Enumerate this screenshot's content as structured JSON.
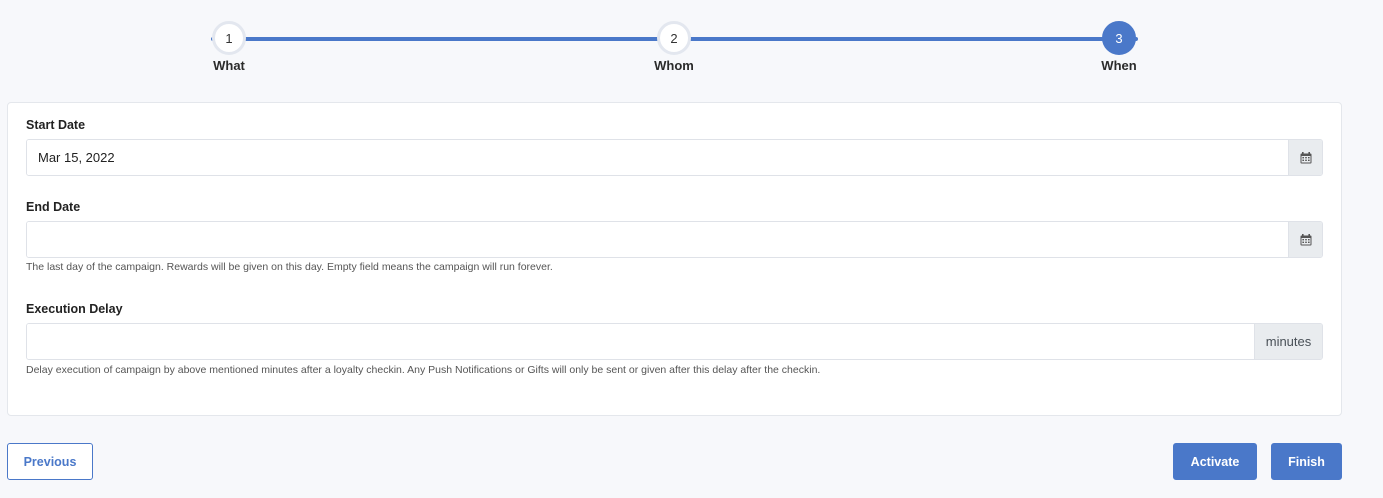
{
  "stepper": {
    "steps": [
      {
        "number": "1",
        "label": "What",
        "active": false
      },
      {
        "number": "2",
        "label": "Whom",
        "active": false
      },
      {
        "number": "3",
        "label": "When",
        "active": true
      }
    ],
    "accent_color": "#4a78c9"
  },
  "form": {
    "start_date": {
      "label": "Start Date",
      "value": "Mar 15, 2022",
      "addon_icon": "calendar-icon"
    },
    "end_date": {
      "label": "End Date",
      "value": "",
      "addon_icon": "calendar-icon",
      "help": "The last day of the campaign. Rewards will be given on this day. Empty field means the campaign will run forever."
    },
    "execution_delay": {
      "label": "Execution Delay",
      "value": "",
      "addon_text": "minutes",
      "help": "Delay execution of campaign by above mentioned minutes after a loyalty checkin. Any Push Notifications or Gifts will only be sent or given after this delay after the checkin."
    }
  },
  "footer": {
    "previous_label": "Previous",
    "activate_label": "Activate",
    "finish_label": "Finish"
  }
}
